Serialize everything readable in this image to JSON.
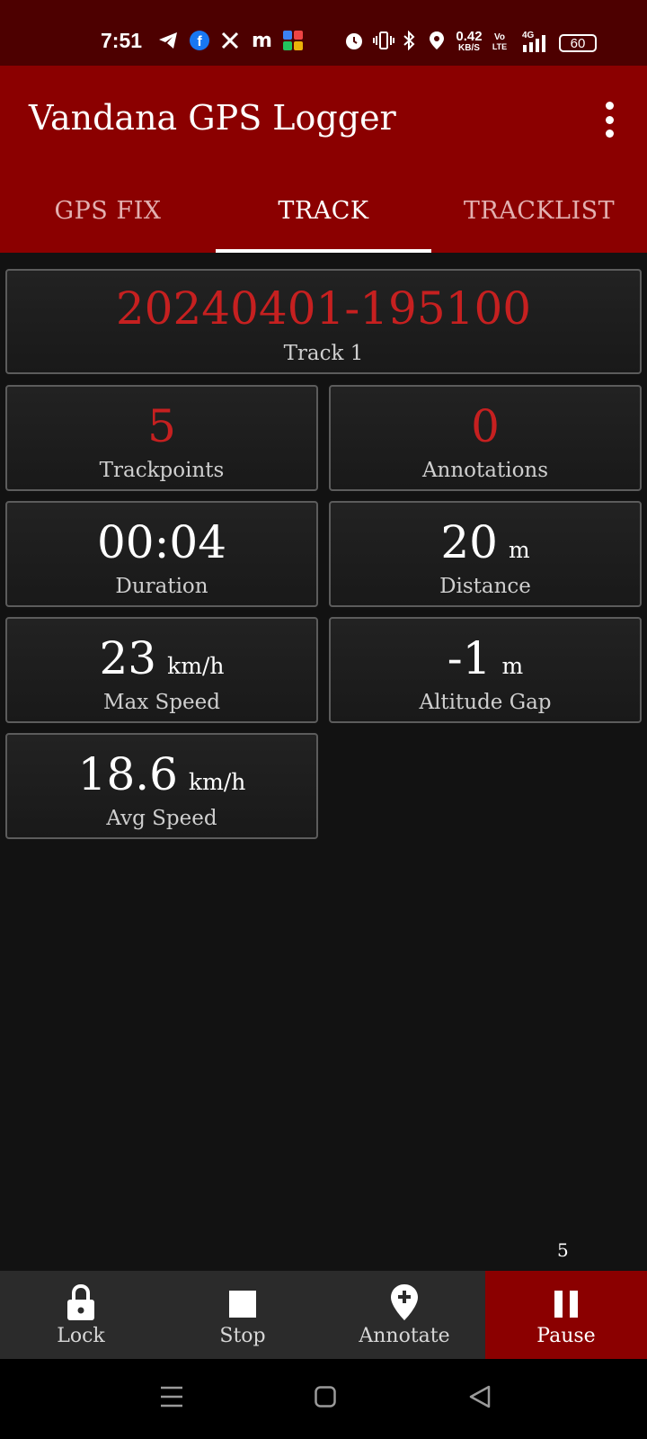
{
  "status_bar": {
    "time": "7:51",
    "net_speed_value": "0.42",
    "net_speed_unit": "KB/S",
    "volte_top": "Vo",
    "volte_bottom": "LTE",
    "network": "4G",
    "battery": "60",
    "icons": [
      "telegram-icon",
      "facebook-icon",
      "x-icon",
      "m-icon",
      "app-grid-icon",
      "alarm-icon",
      "vibrate-icon",
      "bluetooth-icon",
      "location-icon",
      "signal-icon",
      "battery-icon"
    ]
  },
  "app_bar": {
    "title": "Vandana GPS Logger"
  },
  "tabs": [
    {
      "label": "GPS FIX"
    },
    {
      "label": "TRACK"
    },
    {
      "label": "TRACKLIST"
    }
  ],
  "track": {
    "name": "20240401-195100",
    "name_label": "Track 1",
    "trackpoints": "5",
    "trackpoints_label": "Trackpoints",
    "annotations": "0",
    "annotations_label": "Annotations",
    "duration": "00:04",
    "duration_label": "Duration",
    "distance": "20",
    "distance_unit": "m",
    "distance_label": "Distance",
    "max_speed": "23",
    "max_speed_unit": "km/h",
    "max_speed_label": "Max Speed",
    "altitude_gap": "-1",
    "altitude_gap_unit": "m",
    "altitude_gap_label": "Altitude Gap",
    "avg_speed": "18.6",
    "avg_speed_unit": "km/h",
    "avg_speed_label": "Avg Speed"
  },
  "point_count": "5",
  "bottom_actions": [
    {
      "label": "Lock"
    },
    {
      "label": "Stop"
    },
    {
      "label": "Annotate"
    },
    {
      "label": "Pause"
    }
  ],
  "colors": {
    "app_bar": "#8b0000",
    "status_bar": "#4d0000",
    "accent_red": "#c62020",
    "background": "#121212"
  }
}
